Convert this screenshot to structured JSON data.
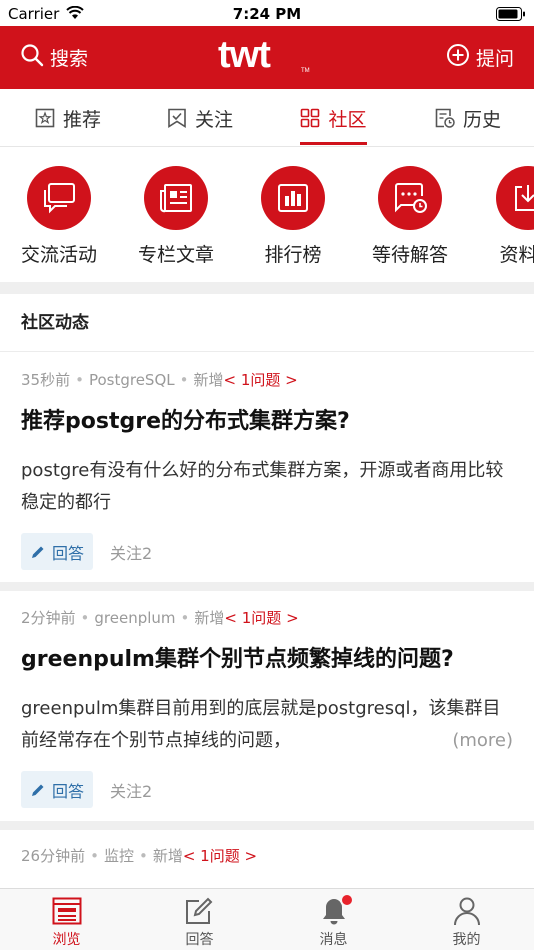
{
  "status_bar": {
    "carrier": "Carrier",
    "time": "7:24 PM"
  },
  "header": {
    "search_label": "搜索",
    "logo_text": "twt",
    "ask_label": "提问"
  },
  "tabs": [
    {
      "label": "推荐",
      "icon": "recommend-icon"
    },
    {
      "label": "关注",
      "icon": "bookmark-icon"
    },
    {
      "label": "社区",
      "icon": "grid-icon",
      "active": true
    },
    {
      "label": "历史",
      "icon": "history-icon"
    }
  ],
  "categories": [
    {
      "label": "交流活动",
      "icon": "chat-icon"
    },
    {
      "label": "专栏文章",
      "icon": "newspaper-icon"
    },
    {
      "label": "排行榜",
      "icon": "chart-icon"
    },
    {
      "label": "等待解答",
      "icon": "waiting-icon"
    },
    {
      "label": "资料下",
      "icon": "download-icon"
    }
  ],
  "section_title": "社区动态",
  "feed": [
    {
      "time": "35秒前",
      "tag": "PostgreSQL",
      "action": "新增",
      "link": "< 1问题 >",
      "title": "推荐postgre的分布式集群方案?",
      "body": "postgre有没有什么好的分布式集群方案，开源或者商用比较稳定的都行",
      "answer_label": "回答",
      "follow_label": "关注2"
    },
    {
      "time": "2分钟前",
      "tag": "greenplum",
      "action": "新增",
      "link": "< 1问题 >",
      "title": "greenpulm集群个别节点频繁掉线的问题?",
      "body": "greenpulm集群目前用到的底层就是postgresql，该集群目前经常存在个别节点掉线的问题，",
      "more": "(more)",
      "answer_label": "回答",
      "follow_label": "关注2"
    },
    {
      "time": "26分钟前",
      "tag": "监控",
      "action": "新增",
      "link": "< 1问题 >"
    }
  ],
  "bottom_nav": [
    {
      "label": "浏览",
      "icon": "browse-icon",
      "active": true
    },
    {
      "label": "回答",
      "icon": "edit-icon"
    },
    {
      "label": "消息",
      "icon": "bell-icon",
      "badge": true
    },
    {
      "label": "我的",
      "icon": "user-icon"
    }
  ],
  "colors": {
    "brand": "#d0121b",
    "answer_text": "#2f6fa8",
    "answer_bg": "#eaf2f8"
  }
}
